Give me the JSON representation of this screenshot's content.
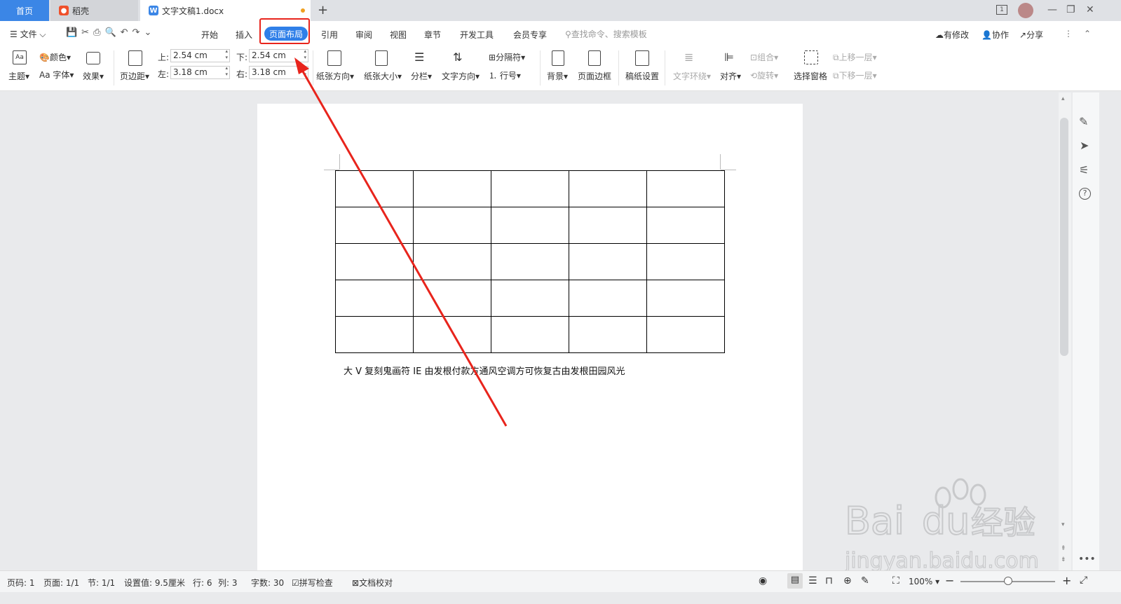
{
  "tabs": {
    "home": "首页",
    "daoke": "稻壳",
    "document": "文字文稿1.docx",
    "new_tab": "+"
  },
  "menu": {
    "file": "文件",
    "items": [
      "开始",
      "插入",
      "页面布局",
      "引用",
      "审阅",
      "视图",
      "章节",
      "开发工具",
      "会员专享"
    ],
    "active": "页面布局",
    "search_placeholder": "查找命令、搜索模板",
    "has_changes": "有修改",
    "collaborate": "协作",
    "share": "分享"
  },
  "ribbon": {
    "theme": "主题",
    "color": "颜色",
    "font": "字体",
    "effect": "效果",
    "margins": "页边距",
    "top_label": "上:",
    "top_value": "2.54 cm",
    "bottom_label": "下:",
    "bottom_value": "2.54 cm",
    "left_label": "左:",
    "left_value": "3.18 cm",
    "right_label": "右:",
    "right_value": "3.18 cm",
    "orientation": "纸张方向",
    "paper_size": "纸张大小",
    "columns": "分栏",
    "text_direction": "文字方向",
    "breaks": "分隔符",
    "line_numbers": "行号",
    "background": "背景",
    "page_border": "页面边框",
    "manuscript": "稿纸设置",
    "text_wrap": "文字环绕",
    "align": "对齐",
    "group": "组合",
    "rotate": "旋转",
    "selection_pane": "选择窗格",
    "bring_forward": "上移一层",
    "send_backward": "下移一层"
  },
  "document": {
    "paragraph": "大 V 复刻鬼画符 IE 由发根付款方通风空调方可恢复古由发根田园风光",
    "table": {
      "rows": 5,
      "cols": 5
    }
  },
  "status": {
    "page_num": "页码: 1",
    "pages": "页面: 1/1",
    "section": "节: 1/1",
    "setting": "设置值: 9.5厘米",
    "row": "行: 6",
    "col": "列: 3",
    "word_count": "字数: 30",
    "spell_check": "拼写检查",
    "doc_proof": "文档校对",
    "zoom": "100%"
  },
  "watermark": {
    "brand": "Bai",
    "brand_du": "du",
    "jingyan": "经验",
    "url": "jingyan.baidu.com"
  },
  "colors": {
    "accent": "#2f7fe8",
    "annotation_red": "#e8241c"
  }
}
